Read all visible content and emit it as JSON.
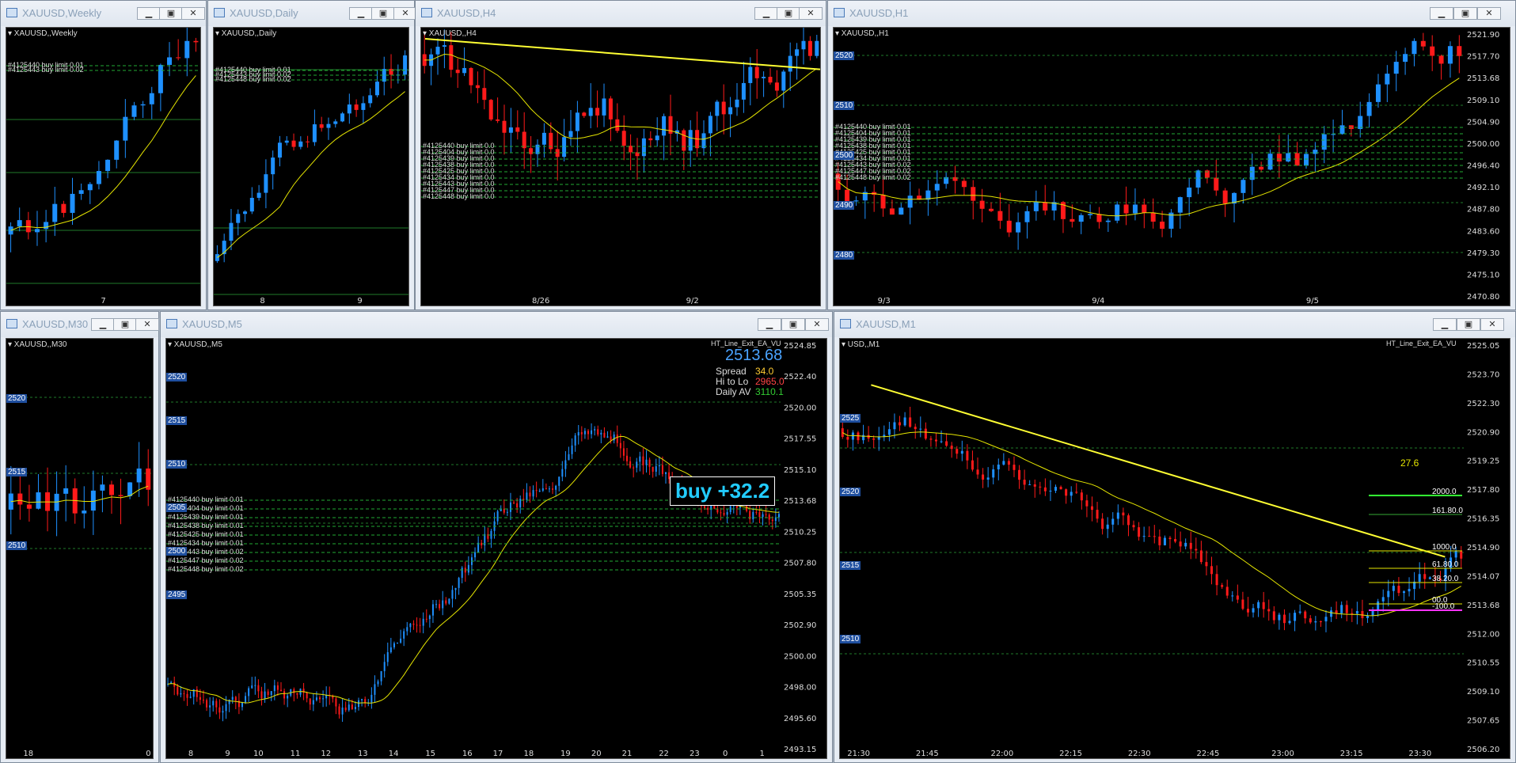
{
  "colors": {
    "bull": "#1e90ff",
    "bear": "#ff1a1a",
    "ma": "#e6e600",
    "grid_green": "#1f7a2a",
    "order_green": "#22aa33",
    "trend": "#ffff33"
  },
  "windows": [
    {
      "id": "weekly",
      "title": "XAUUSD,Weekly",
      "label": "XAUUSD,,Weekly",
      "order_labels": [
        "#4125440 buy limit 0.01",
        "#4125443 buy limit 0.02"
      ],
      "x_ticks": [
        "7"
      ],
      "y_ticks": []
    },
    {
      "id": "daily",
      "title": "XAUUSD,Daily",
      "label": "XAUUSD,,Daily",
      "order_labels": [
        "#4125440 buy limit 0.01",
        "#4125443 buy limit 0.02",
        "#4125448 buy limit 0.02"
      ],
      "x_ticks": [
        "8",
        "9"
      ],
      "y_ticks": []
    },
    {
      "id": "h4",
      "title": "XAUUSD,H4",
      "label": "XAUUSD,,H4",
      "order_labels": [
        "#4125440 buy limit 0.0",
        "#4125404 buy limit 0.0",
        "#4125439 buy limit 0.0",
        "#4125438 buy limit 0.0",
        "#4125425 buy limit 0.0",
        "#4125434 buy limit 0.0",
        "#4125443 buy limit 0.0",
        "#4125447 buy limit 0.0",
        "#4125448 buy limit 0.0"
      ],
      "x_ticks": [
        "8/26",
        "9/2"
      ],
      "y_ticks": []
    },
    {
      "id": "h1",
      "title": "XAUUSD,H1",
      "label": "XAUUSD,,H1",
      "order_labels": [
        "#4125440 buy limit 0.01",
        "#4125404 buy limit 0.01",
        "#4125439 buy limit 0.01",
        "#4125438 buy limit 0.01",
        "#4125425 buy limit 0.01",
        "#4125434 buy limit 0.01",
        "#4125443 buy limit 0.02",
        "#4125447 buy limit 0.02",
        "#4125448 buy limit 0.02"
      ],
      "x_ticks": [
        "9/3",
        "9/4",
        "9/5"
      ],
      "y_ticks": [
        "2521.90",
        "2517.70",
        "2513.68",
        "2509.10",
        "2504.90",
        "2500.00",
        "2496.40",
        "2492.10",
        "2487.80",
        "2483.60",
        "2479.30",
        "2475.10",
        "2470.80"
      ],
      "price_labels": [
        "2520",
        "2510",
        "2500",
        "2490",
        "2480"
      ]
    },
    {
      "id": "m30",
      "title": "XAUUSD,M30",
      "label": "XAUUSD,,M30",
      "order_labels": [],
      "x_ticks": [
        "18",
        "0"
      ],
      "y_ticks": [],
      "price_labels": [
        "2520",
        "2515",
        "2510"
      ]
    },
    {
      "id": "m5",
      "title": "XAUUSD,M5",
      "label": "XAUUSD,,M5",
      "ea_name": "HT_Line_Exit_EA_VU",
      "price": "2513.68",
      "spread_label": "Spread",
      "spread_value": "34.0",
      "hilo_label": "Hi to Lo",
      "hilo_value": "2965.0",
      "dailyav_label": "Daily AV",
      "dailyav_value": "3110.1",
      "profit": "buy +32.2",
      "order_labels": [
        "#4125440 buy limit 0.01",
        "#4125404 buy limit 0.01",
        "#4125439 buy limit 0.01",
        "#4125438 buy limit 0.01",
        "#4125425 buy limit 0.01",
        "#4125434 buy limit 0.01",
        "#4125443 buy limit 0.02",
        "#4125447 buy limit 0.02",
        "#4125448 buy limit 0.02"
      ],
      "x_ticks": [
        "8",
        "9",
        "10",
        "11",
        "12",
        "13",
        "14",
        "15",
        "16",
        "17",
        "18",
        "19",
        "20",
        "21",
        "22",
        "23",
        "0",
        "1"
      ],
      "y_ticks": [
        "2524.85",
        "2522.40",
        "2520.00",
        "2517.55",
        "2515.10",
        "2513.68",
        "2510.25",
        "2507.80",
        "2505.35",
        "2502.90",
        "2500.00",
        "2498.00",
        "2495.60",
        "2493.15"
      ],
      "price_labels": [
        "2520",
        "2515",
        "2510",
        "2505",
        "2500",
        "2495"
      ]
    },
    {
      "id": "m1",
      "title": "XAUUSD,M1",
      "label": "USD,,M1",
      "ea_name": "HT_Line_Exit_EA_VU",
      "trend_value": "27.6",
      "level_labels": [
        "2000.0",
        "161.80.0",
        "1000.0",
        "61.80.0",
        "38.20.0",
        "00.0",
        "-100.0"
      ],
      "x_ticks": [
        "21:30",
        "21:45",
        "22:00",
        "22:15",
        "22:30",
        "22:45",
        "23:00",
        "23:15",
        "23:30"
      ],
      "y_ticks": [
        "2525.05",
        "2523.70",
        "2522.30",
        "2520.90",
        "2519.25",
        "2517.80",
        "2516.35",
        "2514.90",
        "2514.07",
        "2513.68",
        "2512.00",
        "2510.55",
        "2509.10",
        "2507.65",
        "2506.20"
      ],
      "price_labels": [
        "2525",
        "2520",
        "2515",
        "2510"
      ]
    }
  ]
}
